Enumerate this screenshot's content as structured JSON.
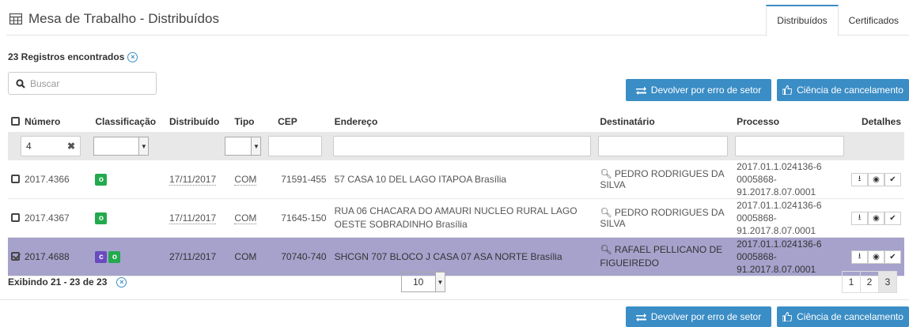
{
  "header": {
    "title": "Mesa de Trabalho - Distribuídos",
    "tabs": [
      {
        "label": "Distribuídos",
        "active": true
      },
      {
        "label": "Certificados",
        "active": false
      }
    ]
  },
  "records": {
    "label": "23 Registros encontrados"
  },
  "search": {
    "placeholder": "Buscar",
    "value": ""
  },
  "buttons": {
    "devolver": "Devolver por erro de setor",
    "ciencia": "Ciência de cancelamento"
  },
  "table": {
    "columns": [
      "Número",
      "Classificação",
      "Distribuído",
      "Tipo",
      "CEP",
      "Endereço",
      "Destinatário",
      "Processo",
      "Detalhes"
    ],
    "filters": {
      "numero": "4"
    },
    "rows": [
      {
        "numero": "2017.4366",
        "checked": false,
        "badges": [
          "o"
        ],
        "distribuido": "17/11/2017",
        "tipo": "COM",
        "cep": "71591-455",
        "endereco": "57 CASA 10 DEL LAGO ITAPOA Brasília",
        "destinatario": "PEDRO RODRIGUES DA SILVA",
        "processo1": "2017.01.1.024136-6",
        "processo2": "0005868-91.2017.8.07.0001"
      },
      {
        "numero": "2017.4367",
        "checked": false,
        "badges": [
          "o"
        ],
        "distribuido": "17/11/2017",
        "tipo": "COM",
        "cep": "71645-150",
        "endereco": "RUA 06 CHACARA DO AMAURI NUCLEO RURAL LAGO OESTE SOBRADINHO Brasília",
        "destinatario": "PEDRO RODRIGUES DA SILVA",
        "processo1": "2017.01.1.024136-6",
        "processo2": "0005868-91.2017.8.07.0001"
      },
      {
        "numero": "2017.4688",
        "checked": true,
        "badges": [
          "c",
          "o"
        ],
        "distribuido": "27/11/2017",
        "tipo": "COM",
        "cep": "70740-740",
        "endereco": "SHCGN 707 BLOCO J CASA 07 ASA NORTE Brasília",
        "destinatario": "RAFAEL PELLICANO DE FIGUEIREDO",
        "processo1": "2017.01.1.024136-6",
        "processo2": "0005868-91.2017.8.07.0001"
      }
    ]
  },
  "footer": {
    "showing": "Exibindo 21 - 23 de 23",
    "per_page": "10",
    "pages": [
      "1",
      "2",
      "3"
    ],
    "active_page": "3"
  },
  "colors": {
    "accent": "#3a8dc5",
    "selected_row": "#a6a2cc",
    "badge_o": "#23a94e",
    "badge_c": "#6a4bbf"
  }
}
